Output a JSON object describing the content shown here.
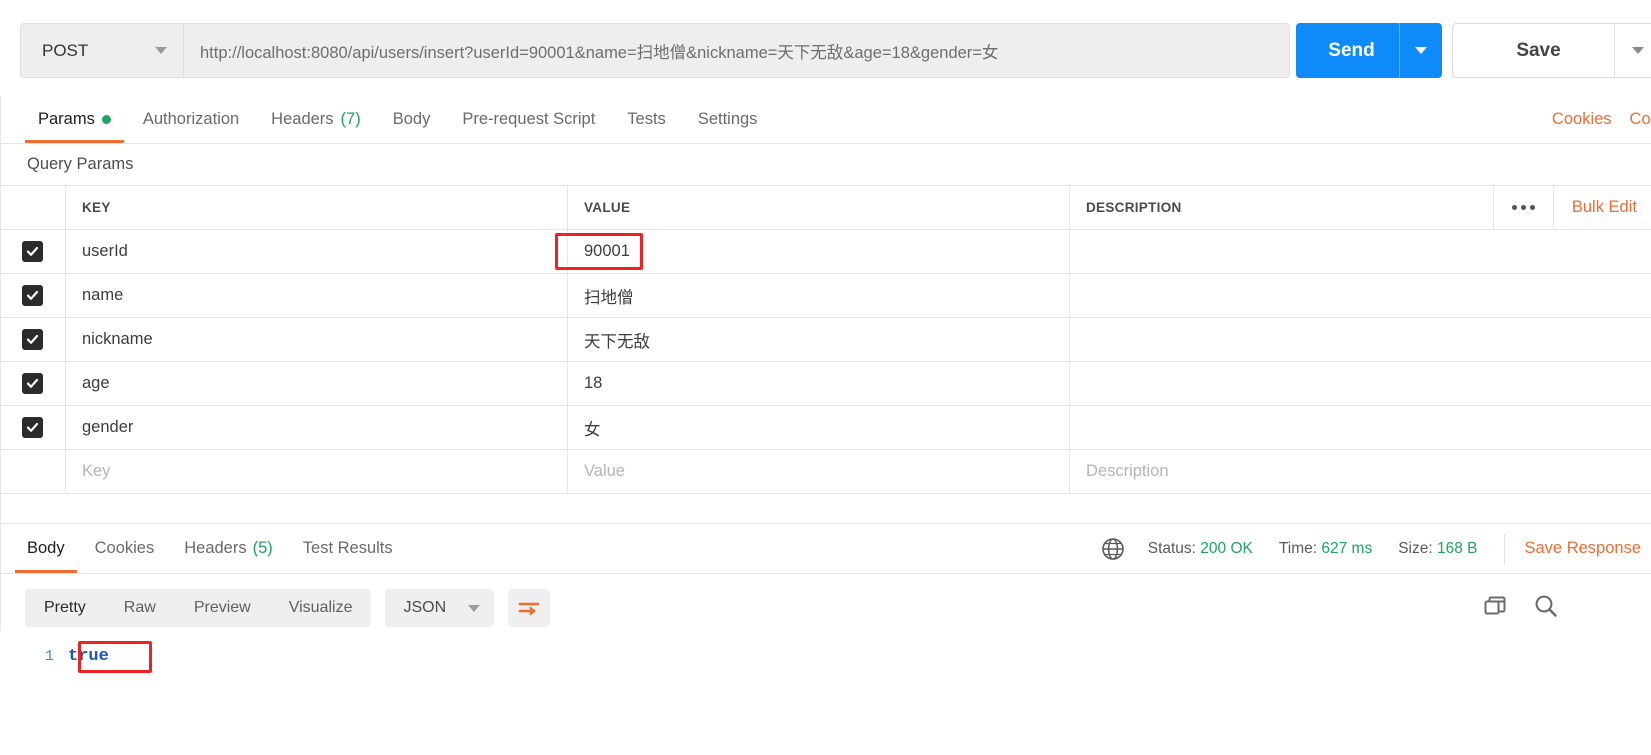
{
  "request": {
    "method": "POST",
    "url": "http://localhost:8080/api/users/insert?userId=90001&name=扫地僧&nickname=天下无敌&age=18&gender=女",
    "send_label": "Send",
    "save_label": "Save"
  },
  "request_tabs": [
    {
      "label": "Params",
      "badge": "dot",
      "active": true
    },
    {
      "label": "Authorization",
      "badge": "",
      "active": false
    },
    {
      "label": "Headers",
      "badge": "(7)",
      "active": false
    },
    {
      "label": "Body",
      "badge": "",
      "active": false
    },
    {
      "label": "Pre-request Script",
      "badge": "",
      "active": false
    },
    {
      "label": "Tests",
      "badge": "",
      "active": false
    },
    {
      "label": "Settings",
      "badge": "",
      "active": false
    }
  ],
  "request_tabs_right": [
    {
      "label": "Cookies"
    },
    {
      "label": "Code"
    }
  ],
  "query_params": {
    "section_title": "Query Params",
    "columns": [
      "KEY",
      "VALUE",
      "DESCRIPTION"
    ],
    "bulk_edit_label": "Bulk Edit",
    "rows": [
      {
        "checked": true,
        "key": "userId",
        "value": "90001",
        "description": ""
      },
      {
        "checked": true,
        "key": "name",
        "value": "扫地僧",
        "description": ""
      },
      {
        "checked": true,
        "key": "nickname",
        "value": "天下无敌",
        "description": ""
      },
      {
        "checked": true,
        "key": "age",
        "value": "18",
        "description": ""
      },
      {
        "checked": true,
        "key": "gender",
        "value": "女",
        "description": ""
      }
    ],
    "placeholder_row": {
      "key": "Key",
      "value": "Value",
      "description": "Description"
    }
  },
  "response_tabs": [
    {
      "label": "Body",
      "badge": "",
      "active": true
    },
    {
      "label": "Cookies",
      "badge": "",
      "active": false
    },
    {
      "label": "Headers",
      "badge": "(5)",
      "active": false
    },
    {
      "label": "Test Results",
      "badge": "",
      "active": false
    }
  ],
  "response_meta": {
    "status_label": "Status:",
    "status_value": "200 OK",
    "time_label": "Time:",
    "time_value": "627 ms",
    "size_label": "Size:",
    "size_value": "168 B",
    "save_response_label": "Save Response"
  },
  "body_toolbar": {
    "views": [
      "Pretty",
      "Raw",
      "Preview",
      "Visualize"
    ],
    "active_view": "Pretty",
    "format": "JSON"
  },
  "response_body": {
    "line_number": "1",
    "content": "true"
  },
  "colors": {
    "accent_orange": "#ef6c33",
    "send_blue": "#0f8af9",
    "status_green": "#1da462",
    "annotation_red": "#ee2222"
  }
}
